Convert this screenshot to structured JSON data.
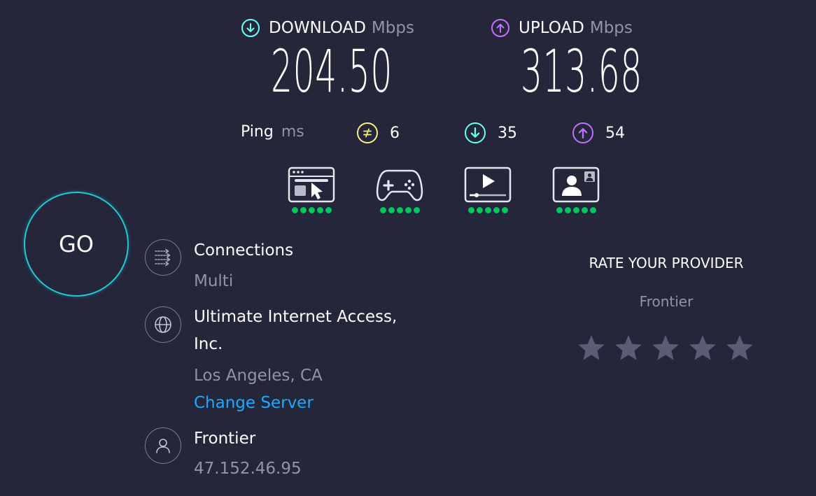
{
  "download": {
    "label": "DOWNLOAD",
    "unit": "Mbps",
    "value": "204.50",
    "color": "#6afff3",
    "icon": "arrow-down-circle-icon"
  },
  "upload": {
    "label": "UPLOAD",
    "unit": "Mbps",
    "value": "313.68",
    "color": "#bf71ff",
    "icon": "arrow-up-circle-icon"
  },
  "ping": {
    "label": "Ping",
    "unit": "ms",
    "jitter": {
      "value": "6",
      "icon": "jitter-icon",
      "color": "#fbee84"
    },
    "download": {
      "value": "35",
      "icon": "arrow-down-circle-icon",
      "color": "#6afff3"
    },
    "upload": {
      "value": "54",
      "icon": "arrow-up-circle-icon",
      "color": "#bf71ff"
    }
  },
  "quality_ratings": [
    {
      "icon": "web-browsing-icon",
      "rating": 5,
      "max": 5
    },
    {
      "icon": "gaming-controller-icon",
      "rating": 5,
      "max": 5
    },
    {
      "icon": "video-streaming-icon",
      "rating": 5,
      "max": 5
    },
    {
      "icon": "video-chat-icon",
      "rating": 5,
      "max": 5
    }
  ],
  "go_button": {
    "label": "GO",
    "ring_color": "#1ccbd8"
  },
  "connections": {
    "icon": "connections-icon",
    "title": "Connections",
    "value": "Multi"
  },
  "server": {
    "icon": "globe-icon",
    "title_line1": "Ultimate Internet Access,",
    "title_line2": "Inc.",
    "location": "Los Angeles, CA",
    "change_label": "Change Server"
  },
  "provider": {
    "icon": "user-icon",
    "name": "Frontier",
    "ip": "47.152.46.95"
  },
  "rate": {
    "title": "RATE YOUR PROVIDER",
    "isp": "Frontier",
    "stars": 5,
    "star_color": "#5b5d74"
  },
  "colors": {
    "background": "#252639",
    "muted_text": "#9193a8",
    "link": "#1ca9ff",
    "good": "#00c65c"
  }
}
